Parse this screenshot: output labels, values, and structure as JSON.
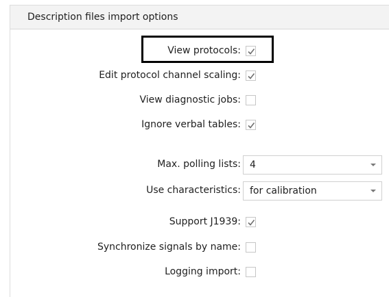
{
  "group": {
    "title": "Description files import options"
  },
  "options": [
    {
      "label": "View protocols:",
      "control": "checkbox",
      "checked": true,
      "highlighted": true
    },
    {
      "label": "Edit protocol channel scaling:",
      "control": "checkbox",
      "checked": true
    },
    {
      "label": "View diagnostic jobs:",
      "control": "checkbox",
      "checked": false
    },
    {
      "label": "Ignore verbal tables:",
      "control": "checkbox",
      "checked": true
    },
    {
      "label": "Max. polling lists:",
      "control": "dropdown",
      "value": "4"
    },
    {
      "label": "Use characteristics:",
      "control": "dropdown",
      "value": "for calibration"
    },
    {
      "label": "Support J1939:",
      "control": "checkbox",
      "checked": true
    },
    {
      "label": "Synchronize signals by name:",
      "control": "checkbox",
      "checked": false
    },
    {
      "label": "Logging import:",
      "control": "checkbox",
      "checked": false
    }
  ],
  "icons": {
    "check": "checkmark-icon",
    "dropdown": "chevron-down-icon"
  },
  "colors": {
    "highlight_border": "#000000",
    "checkmark": "#707070",
    "header_background": "#f3f3f3"
  }
}
